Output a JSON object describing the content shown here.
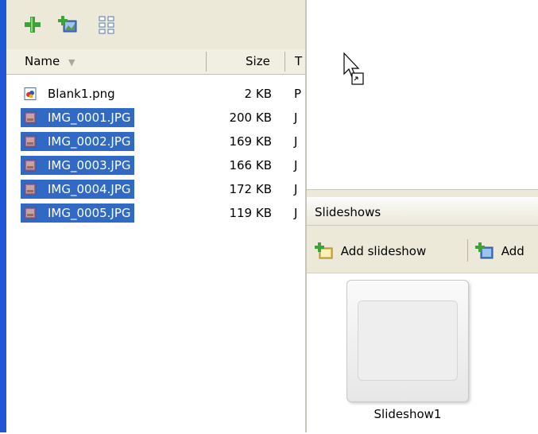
{
  "file_list": {
    "columns": {
      "name": "Name",
      "size": "Size",
      "type": "T"
    },
    "files": [
      {
        "name": "Blank1.png",
        "size": "2 KB",
        "type": "P",
        "selected": false,
        "icon": "png-file-icon"
      },
      {
        "name": "IMG_0001.JPG",
        "size": "200 KB",
        "type": "J",
        "selected": true,
        "icon": "jpg-file-icon"
      },
      {
        "name": "IMG_0002.JPG",
        "size": "169 KB",
        "type": "J",
        "selected": true,
        "icon": "jpg-file-icon"
      },
      {
        "name": "IMG_0003.JPG",
        "size": "166 KB",
        "type": "J",
        "selected": true,
        "icon": "jpg-file-icon"
      },
      {
        "name": "IMG_0004.JPG",
        "size": "172 KB",
        "type": "J",
        "selected": true,
        "icon": "jpg-file-icon"
      },
      {
        "name": "IMG_0005.JPG",
        "size": "119 KB",
        "type": "J",
        "selected": true,
        "icon": "jpg-file-icon"
      }
    ]
  },
  "toolbar": {
    "icons": [
      "add-icon",
      "add-image-icon",
      "grid-view-icon"
    ]
  },
  "slideshows": {
    "title": "Slideshows",
    "add_button": "Add slideshow",
    "add_button_2": "Add",
    "items": [
      {
        "label": "Slideshow1"
      }
    ]
  },
  "colors": {
    "selection": "#316ac5",
    "accent": "#1f56d6",
    "panel_bg": "#ece9d8"
  }
}
